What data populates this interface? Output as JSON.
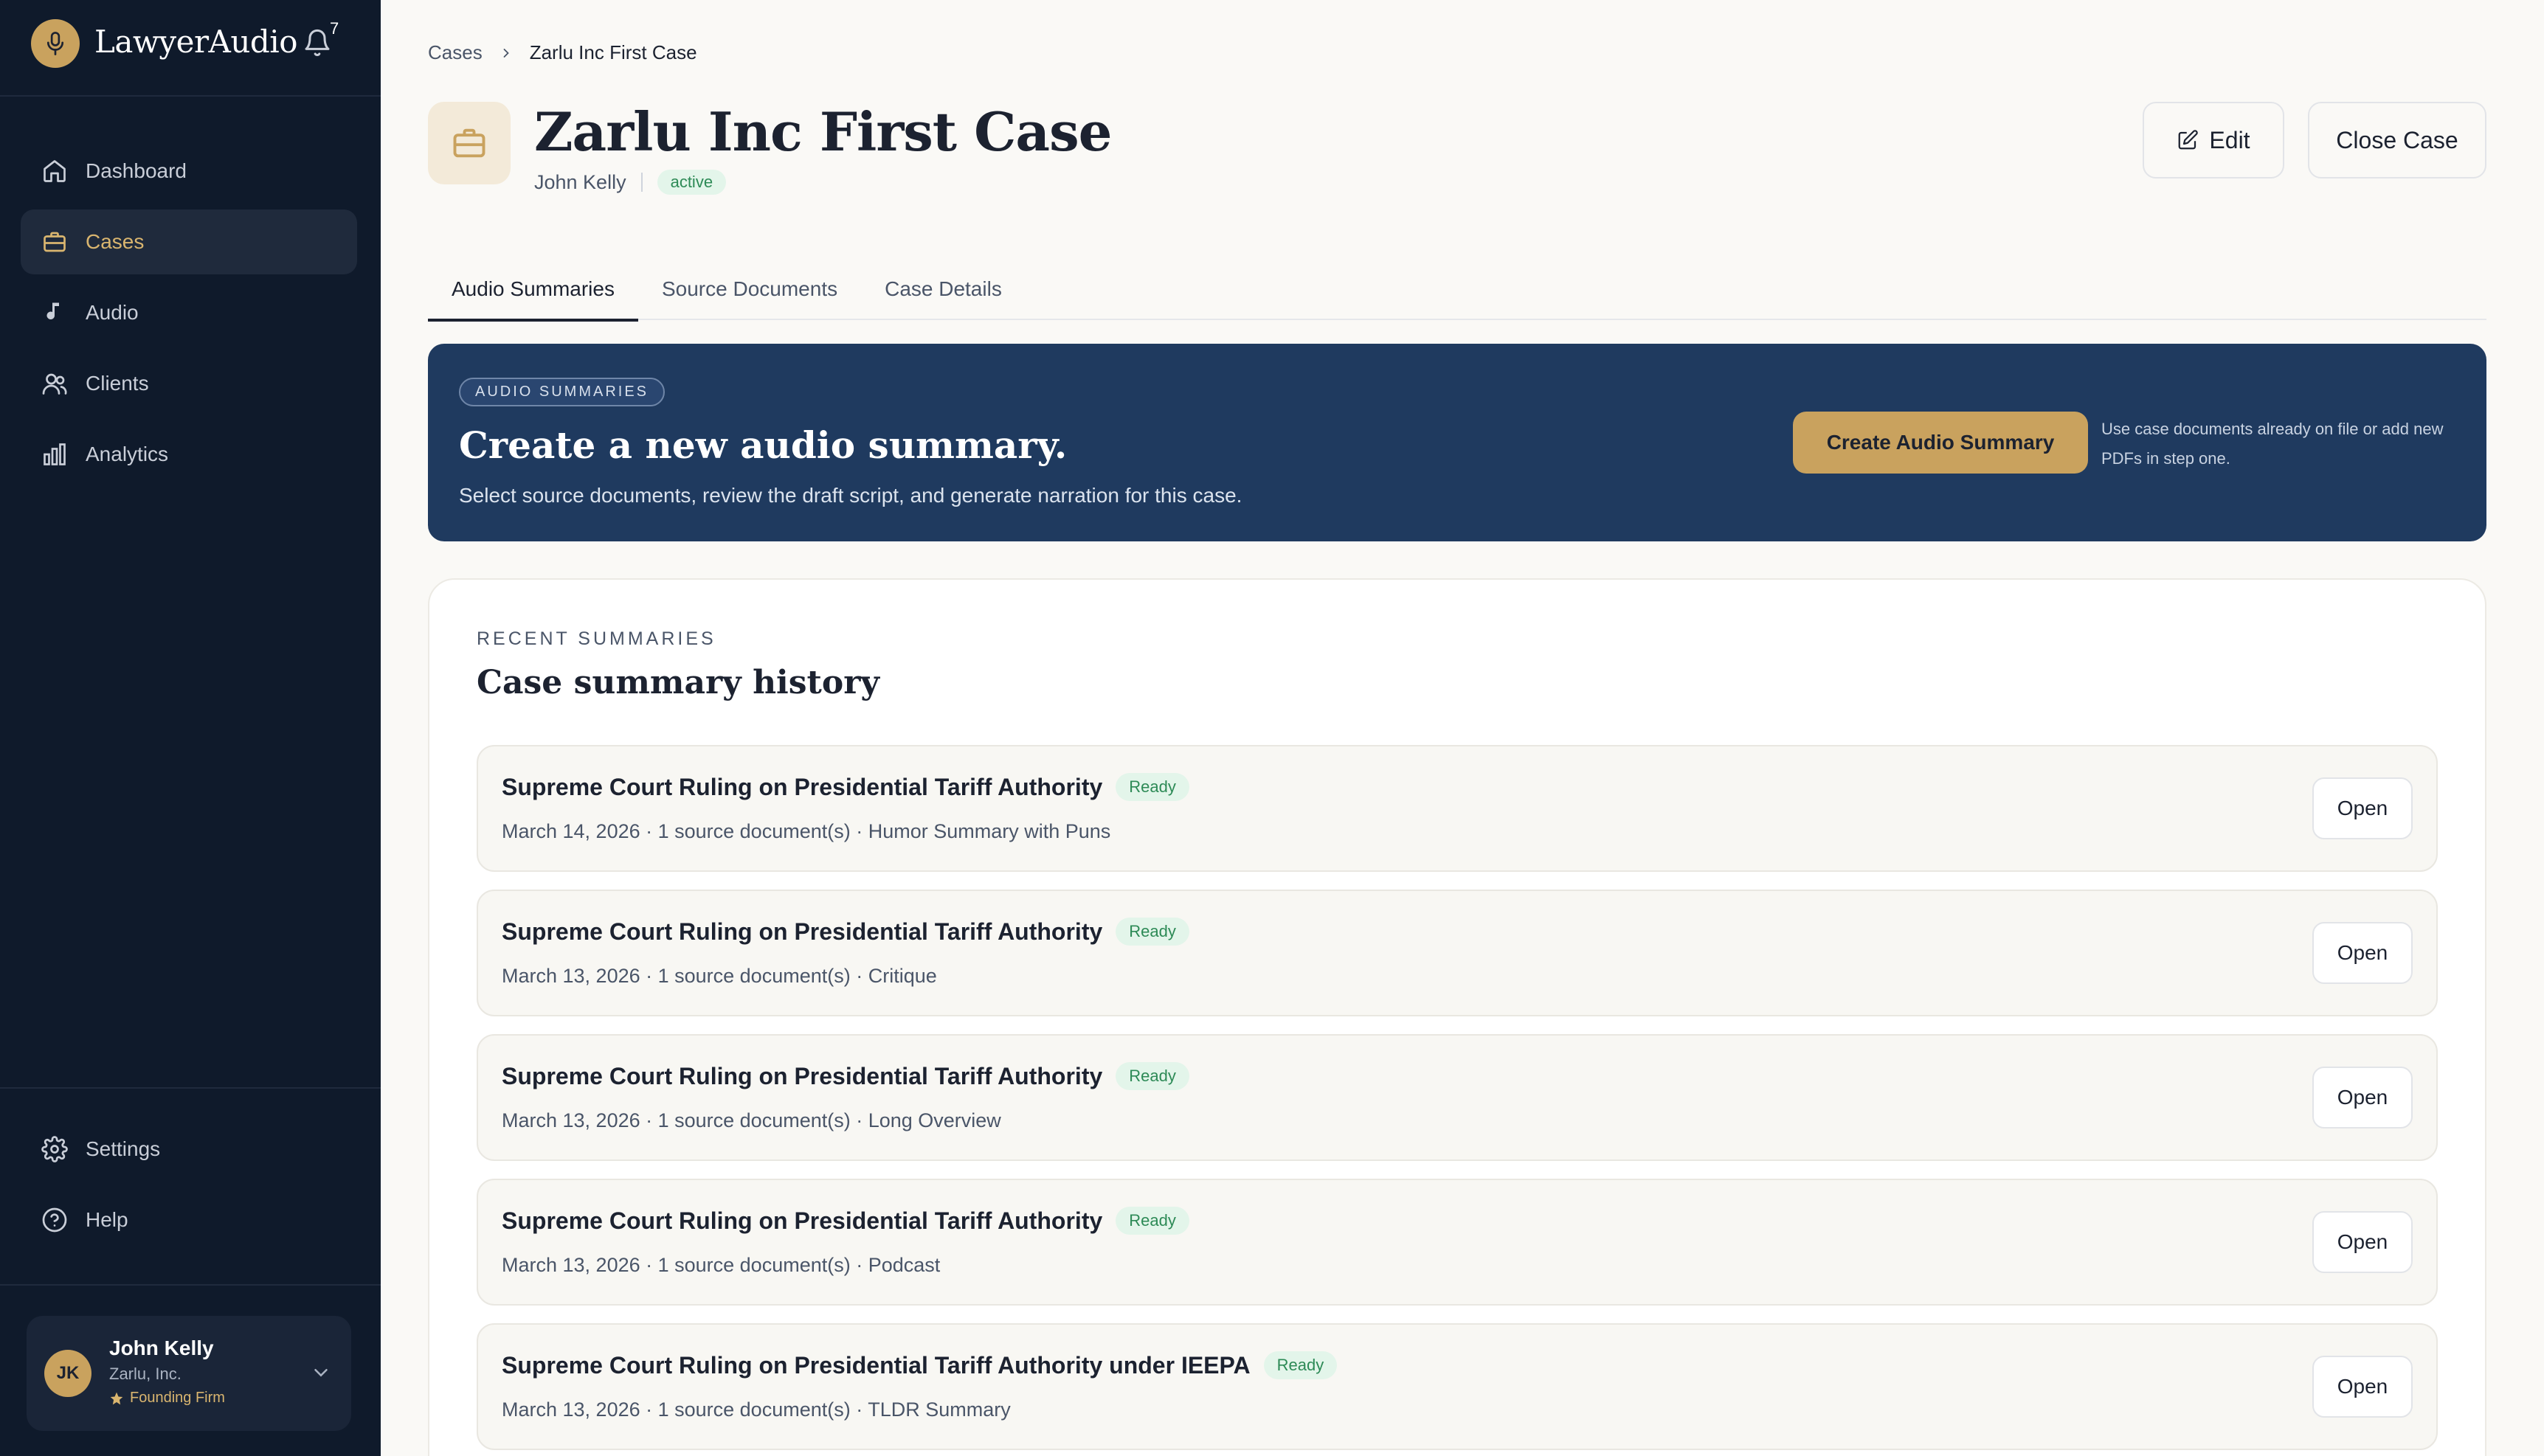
{
  "brand": {
    "name": "LawyerAudio",
    "notification_count": "7"
  },
  "sidebar": {
    "nav": [
      {
        "label": "Dashboard",
        "icon": "home-icon",
        "active": false
      },
      {
        "label": "Cases",
        "icon": "briefcase-icon",
        "active": true
      },
      {
        "label": "Audio",
        "icon": "music-note-icon",
        "active": false
      },
      {
        "label": "Clients",
        "icon": "users-icon",
        "active": false
      },
      {
        "label": "Analytics",
        "icon": "bar-chart-icon",
        "active": false
      }
    ],
    "bottom": [
      {
        "label": "Settings",
        "icon": "gear-icon"
      },
      {
        "label": "Help",
        "icon": "help-circle-icon"
      }
    ],
    "user": {
      "initials": "JK",
      "name": "John Kelly",
      "org": "Zarlu, Inc.",
      "tier": "Founding Firm"
    }
  },
  "breadcrumb": {
    "parent": "Cases",
    "current": "Zarlu Inc First Case"
  },
  "case": {
    "title": "Zarlu Inc First Case",
    "owner": "John Kelly",
    "status": "active",
    "edit_label": "Edit",
    "close_label": "Close Case"
  },
  "tabs": [
    {
      "label": "Audio Summaries",
      "active": true
    },
    {
      "label": "Source Documents",
      "active": false
    },
    {
      "label": "Case Details",
      "active": false
    }
  ],
  "banner": {
    "tag": "AUDIO SUMMARIES",
    "title": "Create a new audio summary.",
    "subtitle": "Select source documents, review the draft script, and generate narration for this case.",
    "button": "Create Audio Summary",
    "hint": "Use case documents already on file or add new PDFs in step one."
  },
  "history": {
    "eyebrow": "RECENT SUMMARIES",
    "title": "Case summary history",
    "open_label": "Open",
    "items": [
      {
        "title": "Supreme Court Ruling on Presidential Tariff Authority",
        "status": "Ready",
        "meta": "March 14, 2026 · 1 source document(s) · Humor Summary with Puns"
      },
      {
        "title": "Supreme Court Ruling on Presidential Tariff Authority",
        "status": "Ready",
        "meta": "March 13, 2026 · 1 source document(s) · Critique"
      },
      {
        "title": "Supreme Court Ruling on Presidential Tariff Authority",
        "status": "Ready",
        "meta": "March 13, 2026 · 1 source document(s) · Long Overview"
      },
      {
        "title": "Supreme Court Ruling on Presidential Tariff Authority",
        "status": "Ready",
        "meta": "March 13, 2026 · 1 source document(s) · Podcast"
      },
      {
        "title": "Supreme Court Ruling on Presidential Tariff Authority under IEEPA",
        "status": "Ready",
        "meta": "March 13, 2026 · 1 source document(s) · TLDR Summary"
      }
    ]
  },
  "colors": {
    "sidebar_bg": "#0f1a2b",
    "accent_gold": "#c9a25e",
    "banner_bg": "#1f3a5f",
    "ready_green": "#2d8a56"
  }
}
